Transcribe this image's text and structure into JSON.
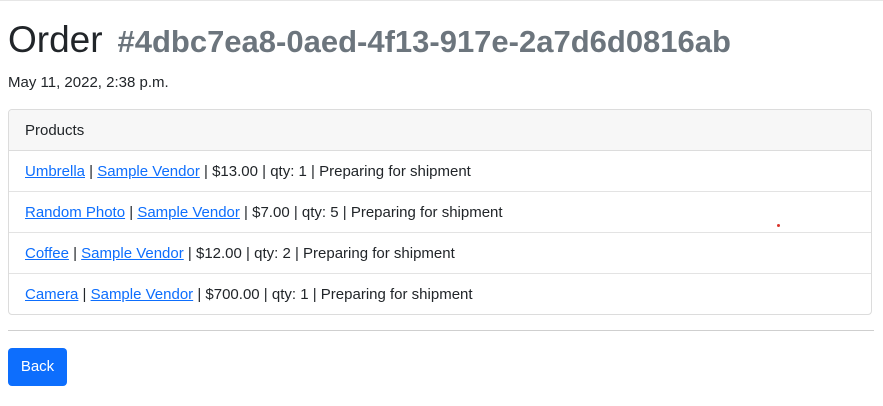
{
  "order": {
    "title_word": "Order",
    "id": "#4dbc7ea8-0aed-4f13-917e-2a7d6d0816ab",
    "date": "May 11, 2022, 2:38 p.m."
  },
  "products": {
    "header": "Products",
    "items": [
      {
        "name": "Umbrella",
        "vendor": "Sample Vendor",
        "price": "$13.00",
        "qty": "qty: 1",
        "status": "Preparing for shipment"
      },
      {
        "name": "Random Photo",
        "vendor": "Sample Vendor",
        "price": "$7.00",
        "qty": "qty: 5",
        "status": "Preparing for shipment"
      },
      {
        "name": "Coffee",
        "vendor": "Sample Vendor",
        "price": "$12.00",
        "qty": "qty: 2",
        "status": "Preparing for shipment"
      },
      {
        "name": "Camera",
        "vendor": "Sample Vendor",
        "price": "$700.00",
        "qty": "qty: 1",
        "status": "Preparing for shipment"
      }
    ],
    "separator": " | "
  },
  "actions": {
    "back_label": "Back"
  },
  "colors": {
    "link": "#0d6efd",
    "button_bg": "#0d6efd",
    "muted_text": "#6c757d"
  }
}
